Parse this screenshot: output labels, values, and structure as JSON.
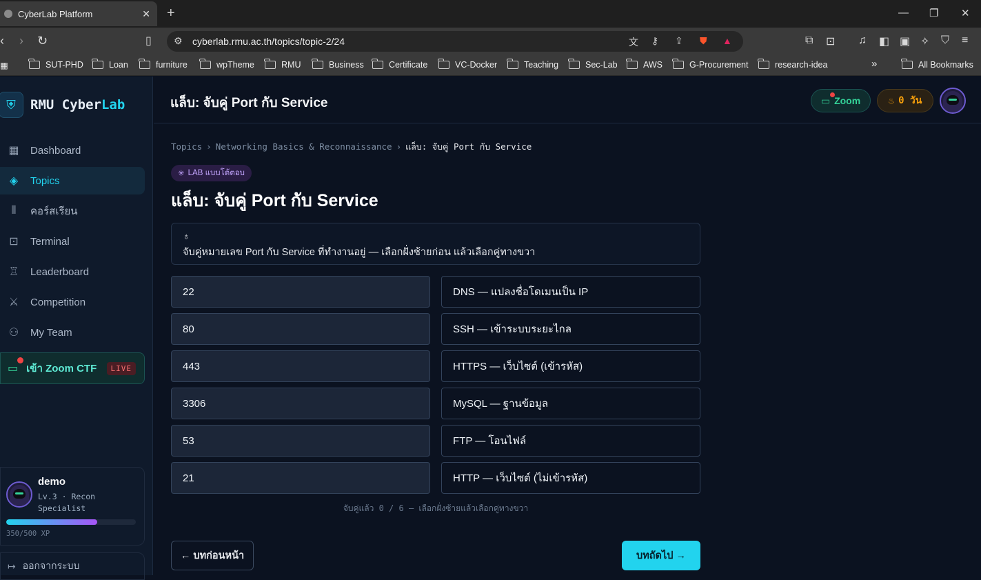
{
  "browser": {
    "tab_title": "CyberLab Platform",
    "url": "cyberlab.rmu.ac.th/topics/topic-2/24",
    "bookmarks": [
      "SUT-PHD",
      "Loan",
      "furniture",
      "wpTheme",
      "RMU",
      "Business",
      "Certificate",
      "VC-Docker",
      "Teaching",
      "Sec-Lab",
      "AWS",
      "G-Procurement",
      "research-idea"
    ],
    "all_bookmarks": "All Bookmarks",
    "overflow": "»"
  },
  "sidebar": {
    "brand_prefix": "RMU Cyber",
    "brand_accent": "Lab",
    "items": [
      {
        "label": "Dashboard",
        "icon": "grid-icon"
      },
      {
        "label": "Topics",
        "icon": "graduation-cap-icon",
        "active": true
      },
      {
        "label": "คอร์สเรียน",
        "icon": "library-icon"
      },
      {
        "label": "Terminal",
        "icon": "terminal-icon"
      },
      {
        "label": "Leaderboard",
        "icon": "trophy-icon"
      },
      {
        "label": "Competition",
        "icon": "swords-icon"
      },
      {
        "label": "My Team",
        "icon": "users-icon"
      }
    ],
    "zoom_ctf": {
      "label": "เข้า Zoom CTF",
      "live": "LIVE"
    },
    "user": {
      "name": "demo",
      "role": "Lv.3 · Recon Specialist",
      "xp_text": "350/500 XP",
      "xp_fraction": 0.7
    },
    "logout": "ออกจากระบบ"
  },
  "header": {
    "title": "แล็บ: จับคู่ Port กับ Service",
    "zoom": "Zoom",
    "streak": "0 วัน"
  },
  "breadcrumb": [
    "Topics",
    "Networking Basics & Reconnaissance",
    "แล็บ: จับคู่ Port กับ Service"
  ],
  "badge": "LAB แบบโต้ตอบ",
  "page_title": "แล็บ: จับคู่ Port กับ Service",
  "hint": "จับคู่หมายเลข Port กับ Service ที่ทำงานอยู่ — เลือกฝั่งซ้ายก่อน แล้วเลือกคู่ทางขวา",
  "ports": [
    "22",
    "80",
    "443",
    "3306",
    "53",
    "21"
  ],
  "services": [
    "DNS — แปลงชื่อโดเมนเป็น IP",
    "SSH — เข้าระบบระยะไกล",
    "HTTPS — เว็บไซต์ (เข้ารหัส)",
    "MySQL — ฐานข้อมูล",
    "FTP — โอนไฟล์",
    "HTTP — เว็บไซต์ (ไม่เข้ารหัส)"
  ],
  "progress_text": "จับคู่แล้ว 0 / 6 — เลือกฝั่งซ้ายแล้วเลือกคู่ทางขวา",
  "nav": {
    "prev": "← บทก่อนหน้า",
    "next": "บทถัดไป →"
  },
  "colors": {
    "accent": "#22d3ee",
    "bg": "#0b1220",
    "sidebar": "#0f1a2b",
    "live": "#ef4444"
  }
}
